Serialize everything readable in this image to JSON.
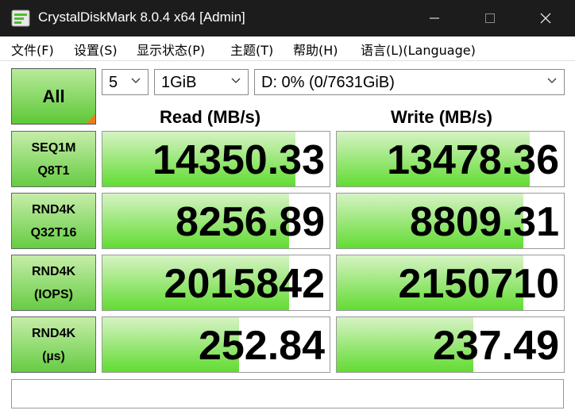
{
  "window": {
    "title": "CrystalDiskMark 8.0.4 x64 [Admin]",
    "buttons": [
      "minimize",
      "maximize",
      "close"
    ]
  },
  "menu": [
    {
      "label": "文件(F)"
    },
    {
      "label": "设置(S)"
    },
    {
      "label": "显示状态(P)"
    },
    {
      "label": "主题(T)"
    },
    {
      "label": "帮助(H)"
    },
    {
      "label": "语言(L)(Language)"
    }
  ],
  "controls": {
    "all_label": "All",
    "test_count": "5",
    "test_size": "1GiB",
    "drive": "D: 0% (0/7631GiB)"
  },
  "headers": {
    "read": "Read (MB/s)",
    "write": "Write (MB/s)"
  },
  "tests": [
    {
      "line1": "SEQ1M",
      "line2": "Q8T1",
      "read": "14350.33",
      "write": "13478.36",
      "read_fill": 0.85,
      "write_fill": 0.85
    },
    {
      "line1": "RND4K",
      "line2": "Q32T16",
      "read": "8256.89",
      "write": "8809.31",
      "read_fill": 0.82,
      "write_fill": 0.82
    },
    {
      "line1": "RND4K",
      "line2": "(IOPS)",
      "read": "2015842",
      "write": "2150710",
      "read_fill": 0.82,
      "write_fill": 0.82
    },
    {
      "line1": "RND4K",
      "line2": "(µs)",
      "read": "252.84",
      "write": "237.49",
      "read_fill": 0.6,
      "write_fill": 0.6
    }
  ],
  "comment": "",
  "colors": {
    "titlebar": "#1c1c1c",
    "bar_green": "#62dc32",
    "label_green": "#66cc43",
    "corner_orange": "#f07a1a"
  }
}
